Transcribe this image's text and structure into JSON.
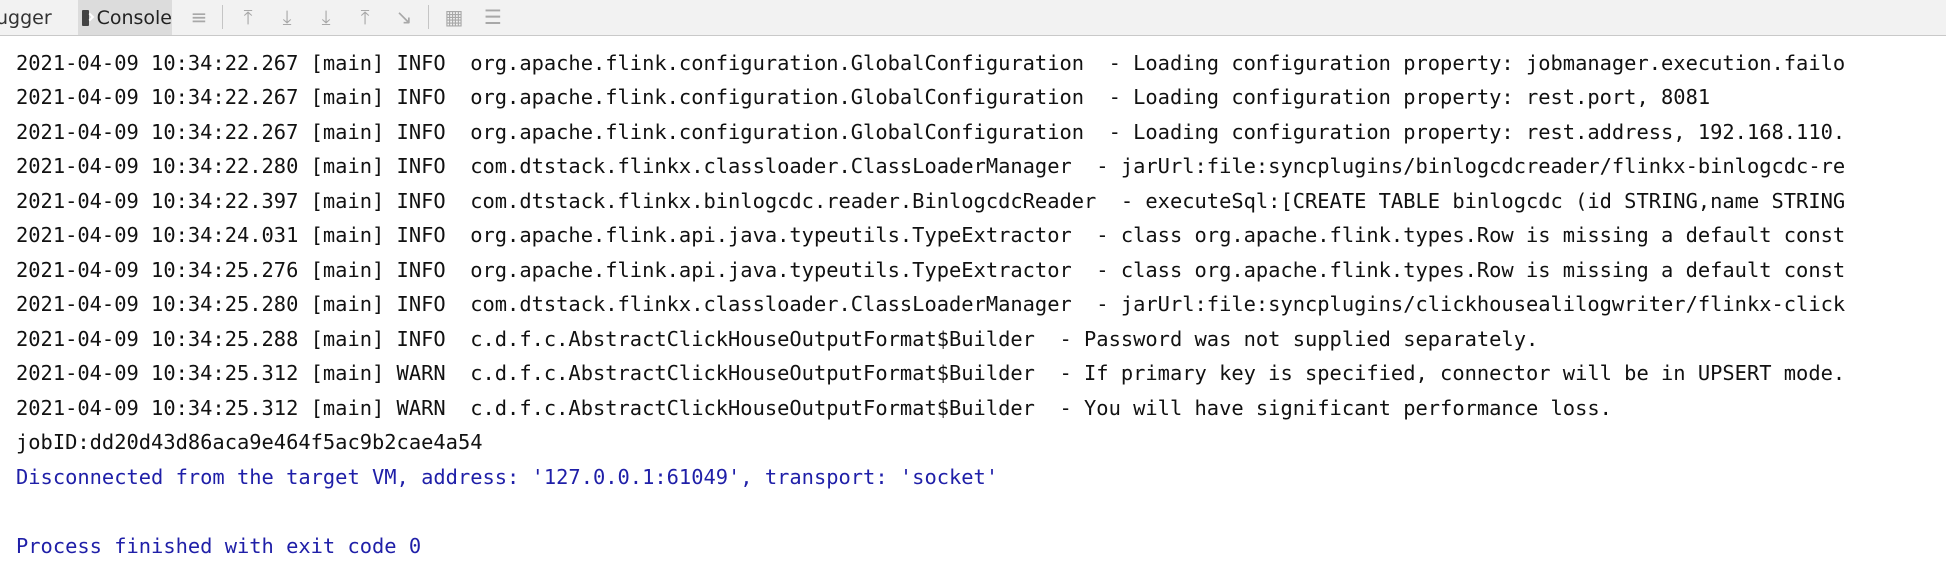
{
  "toolbar": {
    "tabs": [
      {
        "label": "ugger"
      },
      {
        "label": "Console"
      }
    ],
    "icons": [
      "menu-lines-icon",
      "scroll-to-top-icon",
      "step-over-icon",
      "step-into-icon",
      "step-out-icon",
      "run-to-cursor-icon",
      "evaluate-table-icon",
      "trace-settings-icon"
    ]
  },
  "console": {
    "lines": [
      {
        "text": "2021-04-09 10:34:22.267 [main] INFO  org.apache.flink.configuration.GlobalConfiguration  - Loading configuration property: jobmanager.execution.failo",
        "kind": "log"
      },
      {
        "text": "2021-04-09 10:34:22.267 [main] INFO  org.apache.flink.configuration.GlobalConfiguration  - Loading configuration property: rest.port, 8081",
        "kind": "log"
      },
      {
        "text": "2021-04-09 10:34:22.267 [main] INFO  org.apache.flink.configuration.GlobalConfiguration  - Loading configuration property: rest.address, 192.168.110.",
        "kind": "log"
      },
      {
        "text": "2021-04-09 10:34:22.280 [main] INFO  com.dtstack.flinkx.classloader.ClassLoaderManager  - jarUrl:file:syncplugins/binlogcdcreader/flinkx-binlogcdc-re",
        "kind": "log"
      },
      {
        "text": "2021-04-09 10:34:22.397 [main] INFO  com.dtstack.flinkx.binlogcdc.reader.BinlogcdcReader  - executeSql:[CREATE TABLE binlogcdc (id STRING,name STRING",
        "kind": "log"
      },
      {
        "text": "2021-04-09 10:34:24.031 [main] INFO  org.apache.flink.api.java.typeutils.TypeExtractor  - class org.apache.flink.types.Row is missing a default const",
        "kind": "log"
      },
      {
        "text": "2021-04-09 10:34:25.276 [main] INFO  org.apache.flink.api.java.typeutils.TypeExtractor  - class org.apache.flink.types.Row is missing a default const",
        "kind": "log"
      },
      {
        "text": "2021-04-09 10:34:25.280 [main] INFO  com.dtstack.flinkx.classloader.ClassLoaderManager  - jarUrl:file:syncplugins/clickhousealilogwriter/flinkx-click",
        "kind": "log"
      },
      {
        "text": "2021-04-09 10:34:25.288 [main] INFO  c.d.f.c.AbstractClickHouseOutputFormat$Builder  - Password was not supplied separately.",
        "kind": "log"
      },
      {
        "text": "2021-04-09 10:34:25.312 [main] WARN  c.d.f.c.AbstractClickHouseOutputFormat$Builder  - If primary key is specified, connector will be in UPSERT mode.",
        "kind": "log"
      },
      {
        "text": "2021-04-09 10:34:25.312 [main] WARN  c.d.f.c.AbstractClickHouseOutputFormat$Builder  - You will have significant performance loss.",
        "kind": "log"
      },
      {
        "text": "jobID:dd20d43d86aca9e464f5ac9b2cae4a54",
        "kind": "log"
      },
      {
        "text": "Disconnected from the target VM, address: '127.0.0.1:61049', transport: 'socket'",
        "kind": "sys"
      },
      {
        "text": "",
        "kind": "log"
      },
      {
        "text": "Process finished with exit code 0",
        "kind": "sys"
      }
    ]
  }
}
